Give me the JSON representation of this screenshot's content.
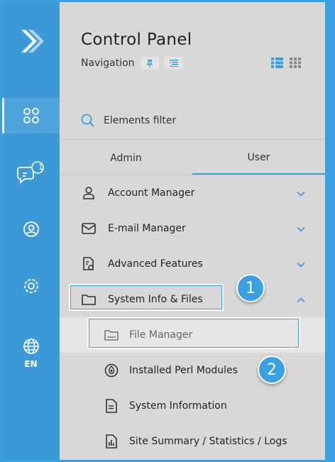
{
  "sidebar": {
    "language": "EN",
    "notification_count": "1",
    "icons": [
      "logo-arrow-icon",
      "apps-grid-icon",
      "chat-icon",
      "user-circle-icon",
      "settings-gear-icon",
      "globe-icon"
    ]
  },
  "header": {
    "title": "Control Panel",
    "subtitle": "Navigation"
  },
  "filter": {
    "placeholder": "Elements filter"
  },
  "tabs": [
    {
      "label": "Admin",
      "selected": false
    },
    {
      "label": "User",
      "selected": true
    }
  ],
  "menu": {
    "account_manager": "Account Manager",
    "email_manager": "E-mail Manager",
    "advanced_features": "Advanced Features",
    "system_info": "System Info & Files",
    "file_manager": "File Manager",
    "perl_modules": "Installed Perl Modules",
    "system_information": "System Information",
    "site_summary": "Site Summary / Statistics / Logs"
  },
  "callouts": {
    "first": "1",
    "second": "2"
  },
  "colors": {
    "accent": "#3b9fe0",
    "panel": "#d8d8d8",
    "text": "#222222"
  }
}
